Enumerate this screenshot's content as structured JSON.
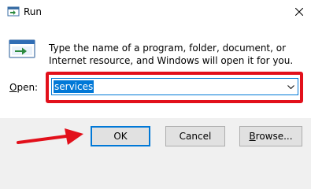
{
  "window": {
    "title": "Run",
    "close_icon": "close-icon"
  },
  "description": "Type the name of a program, folder, document, or Internet resource, and Windows will open it for you.",
  "open_field": {
    "label_mnemonic": "O",
    "label_rest": "pen:",
    "value": "services"
  },
  "buttons": {
    "ok": "OK",
    "cancel": "Cancel",
    "browse_mnemonic": "B",
    "browse_rest": "rowse..."
  },
  "annotation": {
    "highlight_color": "#e2101b",
    "arrow_color": "#e2101b"
  },
  "colors": {
    "accent": "#0078d7",
    "dialog_bg": "#f0f0f0",
    "content_bg": "#ffffff",
    "button_bg": "#e1e1e1"
  }
}
